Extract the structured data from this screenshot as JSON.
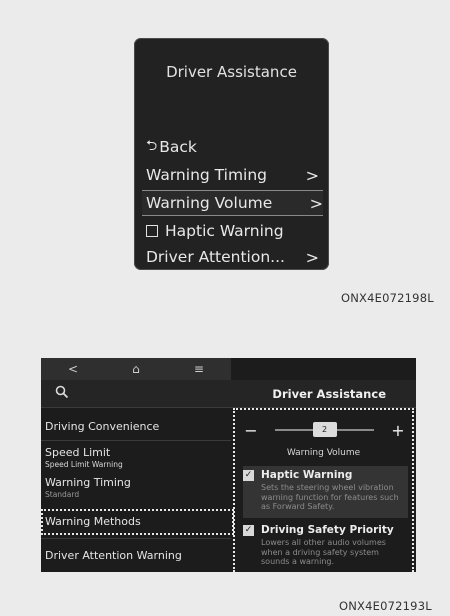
{
  "cluster": {
    "title": "Driver Assistance",
    "items": [
      {
        "label": "Back",
        "type": "back"
      },
      {
        "label": "Warning Timing",
        "type": "submenu"
      },
      {
        "label": "Warning Volume",
        "type": "submenu",
        "selected": true
      },
      {
        "label": "Haptic Warning",
        "type": "checkbox",
        "checked": false
      },
      {
        "label": "Driver Attention...",
        "type": "submenu"
      }
    ],
    "caption": "ONX4E072198L"
  },
  "screen": {
    "topbar": {
      "back": "<",
      "home": "⌂",
      "menu": "≡"
    },
    "header": {
      "search_icon": "magnifier-icon",
      "title": "Driver Assistance"
    },
    "left_menu": [
      {
        "label": "Driving Convenience",
        "sub": ""
      },
      {
        "label": "Speed Limit",
        "sub": "Speed Limit Warning"
      },
      {
        "label": "Warning Timing",
        "sub": "Standard"
      },
      {
        "label": "Warning Methods",
        "sub": ""
      },
      {
        "label": "Driver Attention Warning",
        "sub": ""
      }
    ],
    "volume": {
      "minus": "−",
      "plus": "+",
      "value": "2",
      "label": "Warning Volume",
      "level": 0.5
    },
    "options": [
      {
        "label": "Haptic Warning",
        "checked": true,
        "desc": "Sets the steering wheel vibration warning function for features such as Forward Safety."
      },
      {
        "label": "Driving Safety Priority",
        "checked": true,
        "desc": "Lowers all other audio volumes when a driving safety system sounds a warning."
      }
    ],
    "caption": "ONX4E072193L"
  }
}
